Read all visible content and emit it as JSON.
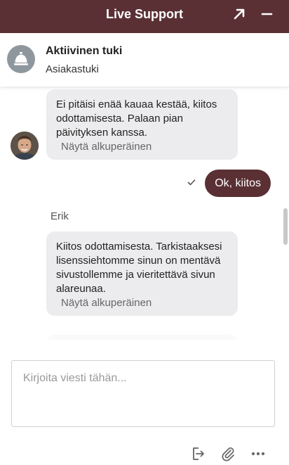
{
  "header": {
    "title": "Live Support",
    "popout_icon": "arrow-up-right-icon",
    "minimize_icon": "minus-icon"
  },
  "agent": {
    "name": "Aktiivinen tuki",
    "department": "Asiakastuki",
    "avatar_icon": "service-bell-icon"
  },
  "messages": [
    {
      "type": "incoming",
      "text": "Ei pitäisi enää kauaa kestää, kiitos odottamisesta. Palaan pian päivityksen kanssa.",
      "show_original": "Näytä alkuperäinen"
    },
    {
      "type": "outgoing",
      "text": "Ok, kiitos",
      "status_icon": "checkmark-icon"
    },
    {
      "type": "incoming",
      "sender": "Erik",
      "text": "Kiitos odottamisesta. Tarkistaaksesi lisenssiehtomme sinun on mentävä sivustollemme ja vieritettävä sivun alareunaa.",
      "show_original": "Näytä alkuperäinen"
    }
  ],
  "composer": {
    "placeholder": "Kirjoita viesti tähän..."
  },
  "footer_icons": [
    "exit-chat-icon",
    "paperclip-icon",
    "more-options-icon"
  ],
  "colors": {
    "brand": "#5a3034",
    "bubble_incoming": "#ececee",
    "avatar_bg": "#8f979e"
  }
}
